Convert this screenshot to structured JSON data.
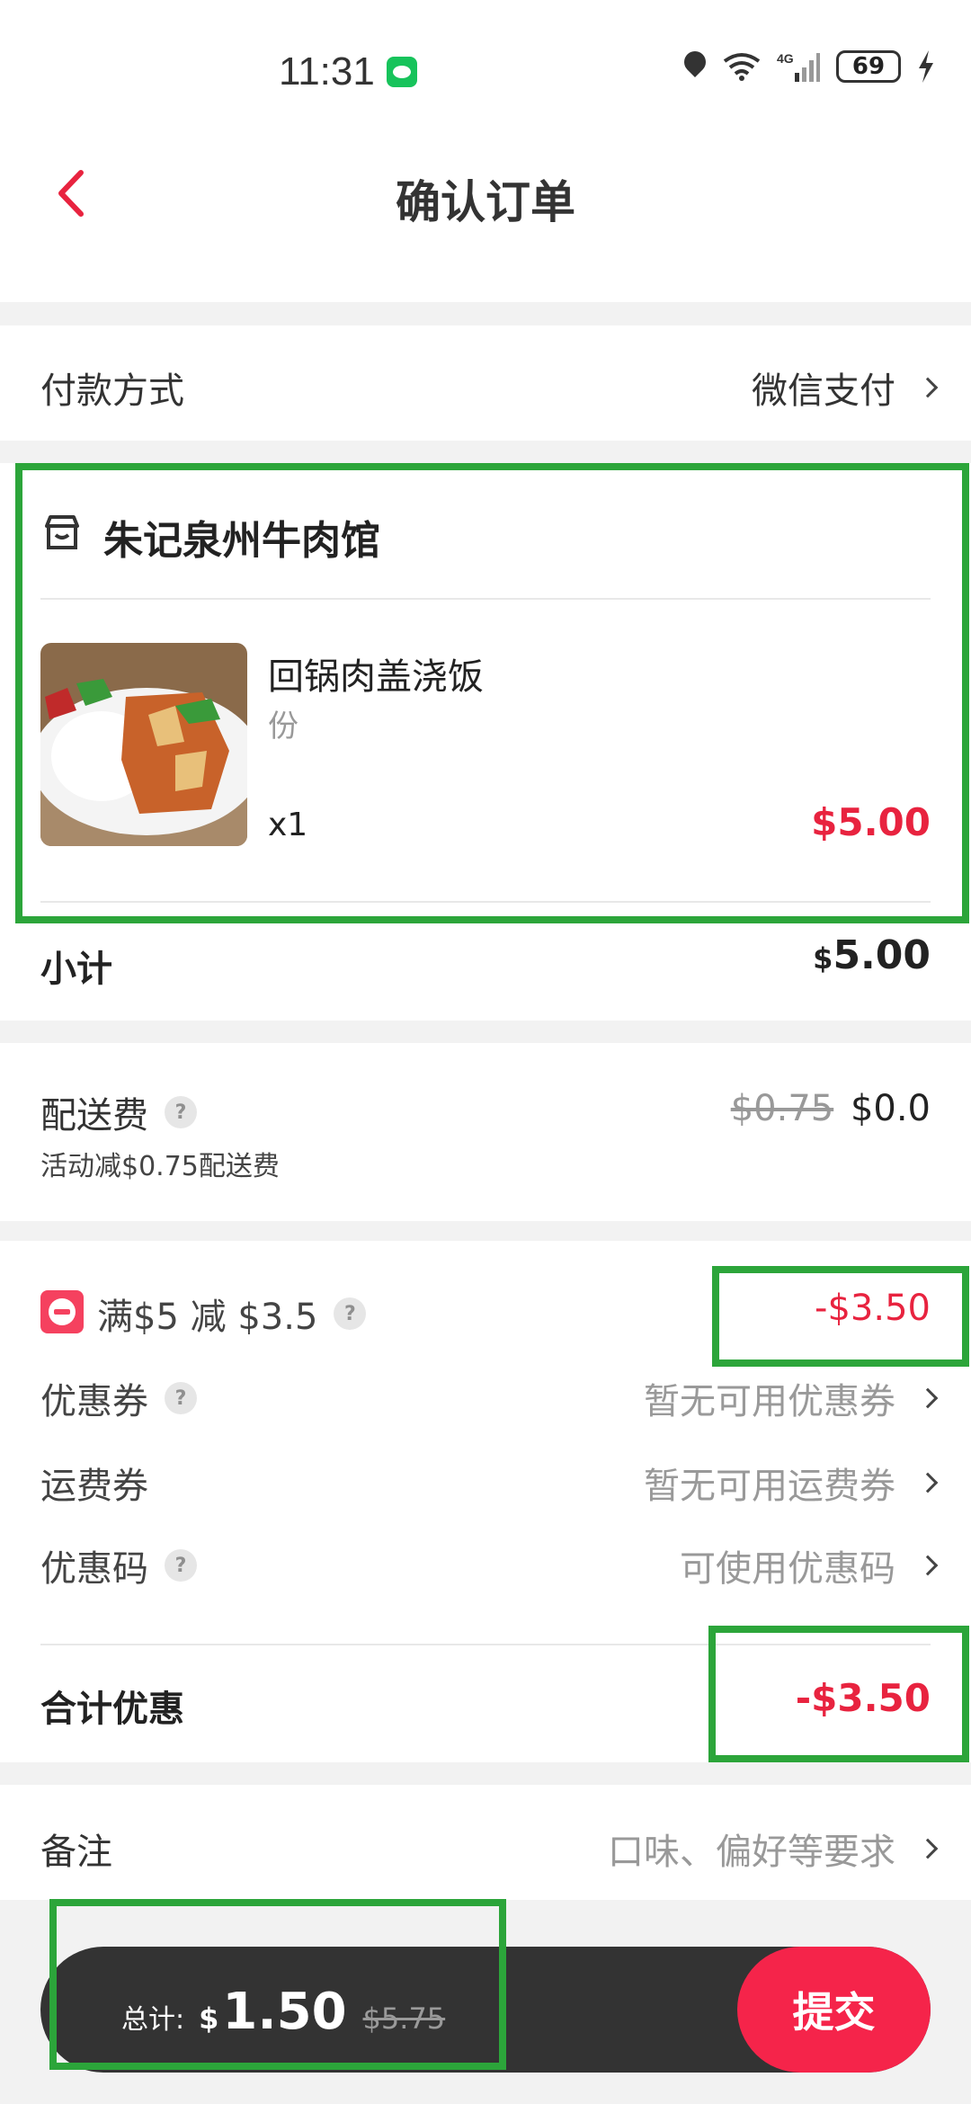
{
  "status_bar": {
    "time": "11:31",
    "battery": "69"
  },
  "header": {
    "title": "确认订单"
  },
  "payment": {
    "label": "付款方式",
    "value": "微信支付"
  },
  "store": {
    "name": "朱记泉州牛肉馆",
    "item": {
      "name": "回锅肉盖浇饭",
      "unit": "份",
      "qty": "x1",
      "price": "$5.00"
    }
  },
  "subtotal": {
    "label": "小计",
    "currency": "$",
    "amount": "5.00"
  },
  "delivery": {
    "label": "配送费",
    "original": "$0.75",
    "current": "$0.0",
    "note": "活动减$0.75配送费"
  },
  "discounts": {
    "promo_label": "满$5 减 $3.5",
    "promo_value": "-$3.50",
    "coupon_label": "优惠券",
    "coupon_value": "暂无可用优惠券",
    "shipping_coupon_label": "运费券",
    "shipping_coupon_value": "暂无可用运费券",
    "promo_code_label": "优惠码",
    "promo_code_value": "可使用优惠码",
    "total_label": "合计优惠",
    "total_value": "-$3.50"
  },
  "remark": {
    "label": "备注",
    "placeholder": "口味、偏好等要求"
  },
  "footer": {
    "total_label": "总计:",
    "currency": "$",
    "total": "1.50",
    "original": "$5.75",
    "submit": "提交"
  },
  "colors": {
    "accent": "#e8233f",
    "highlight": "#2ca53a",
    "footer_bar": "#333333"
  }
}
